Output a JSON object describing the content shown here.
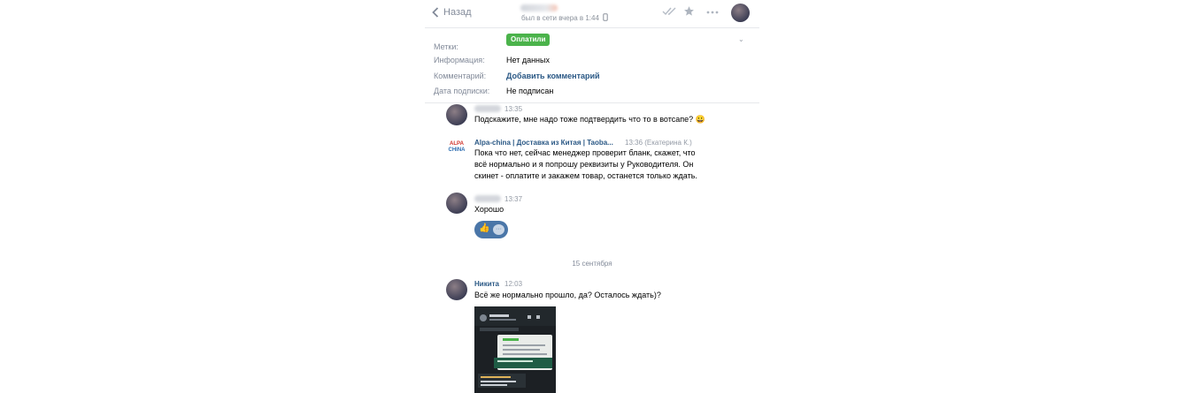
{
  "header": {
    "back_label": "Назад",
    "peer_status": "был в сети вчера в 1:44"
  },
  "info": {
    "tags_label": "Метки:",
    "tag_value": "Оплатили",
    "info_label": "Информация:",
    "info_value": "Нет данных",
    "comment_label": "Комментарий:",
    "comment_value": "Добавить комментарий",
    "subscription_label": "Дата подписки:",
    "subscription_value": "Не подписан"
  },
  "messages": [
    {
      "time": "13:35",
      "text": "Подскажите, мне надо тоже подтвердить что то в вотсапе? 😀"
    },
    {
      "name": "Alpa-china | Доставка из Китая | Taoba...",
      "time": "13:36 (Екатерина К.)",
      "text": "Пока что нет, сейчас менеджер проверит бланк, скажет, что всё нормально и я попрошу реквизиты у Руководителя. Он скинет - оплатите и закажем товар, останется только ждать."
    },
    {
      "time": "13:37",
      "text": "Хорошо"
    },
    {
      "name": "Никита",
      "time": "12:03",
      "text": "Всё же нормально прошло, да? Осталось ждать)?"
    }
  ],
  "reactions": {
    "thumbs": "👍",
    "more": "···"
  },
  "date_separator": "15 сентября",
  "logo": {
    "line1": "ALPA",
    "line2": "CHINA"
  },
  "colors": {
    "accent": "#4a76a8",
    "link": "#2a5885",
    "tag_green": "#4bb34b",
    "muted": "#828a99"
  },
  "icons": [
    "chevron-left-icon",
    "phone-icon",
    "double-check-icon",
    "star-icon",
    "more-icon",
    "chevron-down-icon"
  ]
}
